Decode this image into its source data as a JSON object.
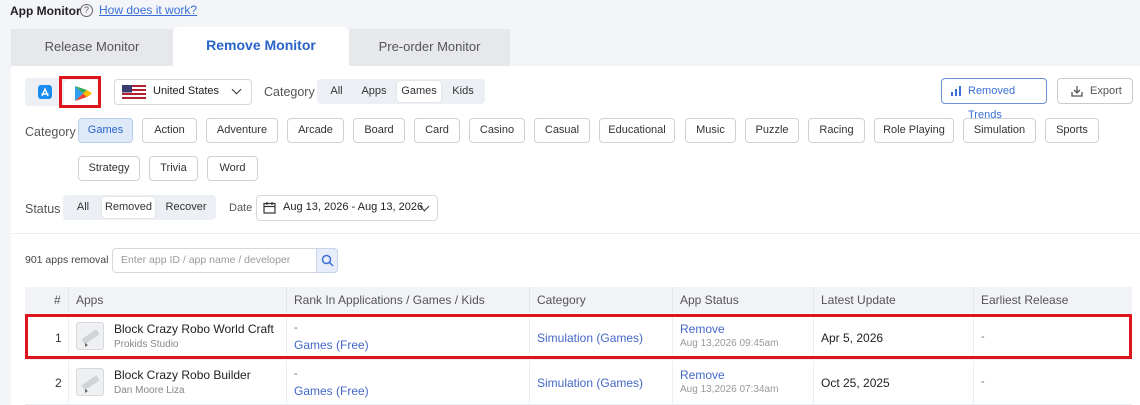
{
  "header": {
    "title": "App Monitor",
    "help_link": "How does it work?"
  },
  "tabs": [
    {
      "label": "Release Monitor",
      "active": false
    },
    {
      "label": "Remove Monitor",
      "active": true
    },
    {
      "label": "Pre-order Monitor",
      "active": false
    }
  ],
  "toolbar": {
    "store_selected": "google-play",
    "country": "United States",
    "category_label": "Category",
    "category_types": [
      "All",
      "Apps",
      "Games",
      "Kids"
    ],
    "category_type_selected": "Games",
    "removed_trends_label": "Removed Trends",
    "export_label": "Export"
  },
  "category_filter": {
    "label": "Category",
    "chips": [
      "Games",
      "Action",
      "Adventure",
      "Arcade",
      "Board",
      "Card",
      "Casino",
      "Casual",
      "Educational",
      "Music",
      "Puzzle",
      "Racing",
      "Role Playing",
      "Simulation",
      "Sports",
      "Strategy",
      "Trivia",
      "Word"
    ],
    "selected": "Games"
  },
  "status_filter": {
    "label": "Status",
    "options": [
      "All",
      "Removed",
      "Recover"
    ],
    "selected": "Removed",
    "date_label": "Date",
    "date_range": "Aug 13, 2026 - Aug 13, 2026"
  },
  "results": {
    "count_text": "901 apps removal",
    "search_placeholder": "Enter app ID / app name / developer"
  },
  "table": {
    "columns": [
      "#",
      "Apps",
      "Rank In Applications / Games / Kids",
      "Category",
      "App Status",
      "Latest Update",
      "Earliest Release"
    ],
    "rows": [
      {
        "index": "1",
        "app_name": "Block Crazy Robo World Craft",
        "developer": "Prokids Studio",
        "rank_line1": "-",
        "rank_line2": "Games (Free)",
        "category": "Simulation (Games)",
        "status": "Remove",
        "status_time": "Aug 13,2026 09:45am",
        "latest_update": "Apr 5, 2026",
        "earliest_release": "-"
      },
      {
        "index": "2",
        "app_name": "Block Crazy Robo Builder",
        "developer": "Dan Moore Liza",
        "rank_line1": "-",
        "rank_line2": "Games (Free)",
        "category": "Simulation (Games)",
        "status": "Remove",
        "status_time": "Aug 13,2026 07:34am",
        "latest_update": "Oct 25, 2025",
        "earliest_release": "-"
      }
    ]
  },
  "colors": {
    "accent": "#2a64c8",
    "highlight_red": "#e0121b",
    "link": "#4468c8"
  }
}
